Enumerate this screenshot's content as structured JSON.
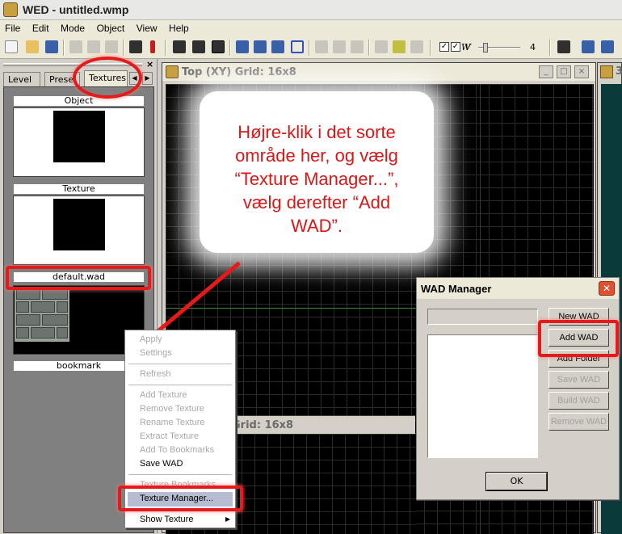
{
  "app": {
    "title": "WED - untitled.wmp"
  },
  "menu": {
    "items": [
      "File",
      "Edit",
      "Mode",
      "Object",
      "View",
      "Help"
    ]
  },
  "toolbar": {
    "check1": "W",
    "check2": "V",
    "slider_value": "4"
  },
  "left_panel": {
    "close_glyph": "×",
    "tabs": [
      "Level",
      "Prese",
      "Textures"
    ],
    "active_tab": "Textures",
    "slots": {
      "object": "Object",
      "texture": "Texture",
      "wad": "default.wad",
      "bookmark": "bookmark"
    }
  },
  "top_view": {
    "title": "Top (XY) Grid: 16x8",
    "min": "_",
    "max": "□",
    "close": "×"
  },
  "bottom_view": {
    "title": "Grid: 16x8"
  },
  "right_view": {
    "title": "3"
  },
  "callout": {
    "lines": [
      "Højre-klik i det sorte",
      "område her, og vælg",
      "“Texture Manager...”,",
      "vælg derefter “Add",
      "WAD”."
    ]
  },
  "context_menu": {
    "items": [
      {
        "label": "Apply",
        "enabled": false
      },
      {
        "label": "Settings",
        "enabled": false
      },
      {
        "label": "Refresh",
        "enabled": false
      },
      {
        "label": "Add Texture",
        "enabled": false
      },
      {
        "label": "Remove Texture",
        "enabled": false
      },
      {
        "label": "Rename Texture",
        "enabled": false
      },
      {
        "label": "Extract Texture",
        "enabled": false
      },
      {
        "label": "Add To Bookmarks",
        "enabled": false
      },
      {
        "label": "Save WAD",
        "enabled": true
      },
      {
        "label": "Texture Bookmarks",
        "enabled": false
      },
      {
        "label": "Texture Manager...",
        "enabled": true,
        "highlighted": true
      },
      {
        "label": "Show Texture",
        "enabled": true,
        "submenu": true
      }
    ]
  },
  "wad_manager": {
    "title": "WAD Manager",
    "buttons": [
      {
        "label": "New WAD",
        "enabled": true
      },
      {
        "label": "Add WAD",
        "enabled": true
      },
      {
        "label": "Add Folder",
        "enabled": true
      },
      {
        "label": "Save WAD",
        "enabled": false
      },
      {
        "label": "Build WAD",
        "enabled": false
      },
      {
        "label": "Remove WAD",
        "enabled": false
      }
    ],
    "ok_label": "OK"
  },
  "colors": {
    "annotation_red": "#e51a1a",
    "callout_text": "#d81818"
  }
}
